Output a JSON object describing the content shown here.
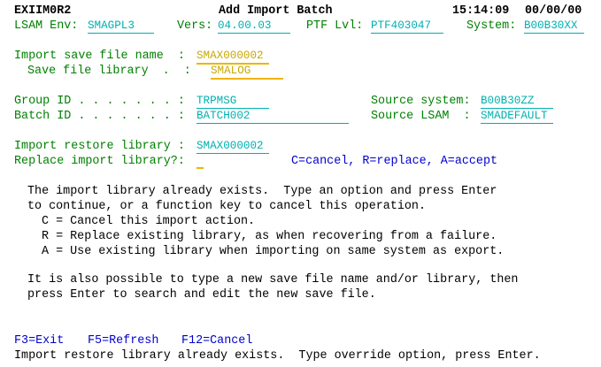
{
  "header": {
    "program_id": "EXIIM0R2",
    "title": "Add Import Batch",
    "time": "15:14:09",
    "date": "00/00/00",
    "lsam_env_label": "LSAM Env:",
    "lsam_env_value": "SMAGPL3",
    "vers_label": "Vers:",
    "vers_value": "04.00.03",
    "ptf_label": "PTF Lvl:",
    "ptf_value": "PTF403047",
    "system_label": "System:",
    "system_value": "B00B30XX"
  },
  "fields": {
    "save_file_name_label": "Import save file name  :",
    "save_file_name_value": "SMAX000002",
    "save_file_library_label": "Save file library  .  :",
    "save_file_library_value": "SMALOG",
    "group_id_label": "Group ID . . . . . . . :",
    "group_id_value": "TRPMSG",
    "source_system_label": "Source system:",
    "source_system_value": "B00B30ZZ",
    "batch_id_label": "Batch ID . . . . . . . :",
    "batch_id_value": "BATCH002",
    "source_lsam_label": "Source LSAM  :",
    "source_lsam_value": "SMADEFAULT",
    "restore_library_label": "Import restore library :",
    "restore_library_value": "SMAX000002",
    "replace_label": "Replace import library?:",
    "replace_value": "",
    "replace_options": "C=cancel, R=replace, A=accept"
  },
  "message": {
    "line1": "The import library already exists.  Type an option and press Enter",
    "line2": "to continue, or a function key to cancel this operation.",
    "line3": "C = Cancel this import action.",
    "line4": "R = Replace existing library, as when recovering from a failure.",
    "line5": "A = Use existing library when importing on same system as export.",
    "line6": "It is also possible to type a new save file name and/or library, then",
    "line7": "press Enter to search and edit the new save file."
  },
  "function_keys": {
    "f3": "F3=Exit",
    "f5": "F5=Refresh",
    "f12": "F12=Cancel"
  },
  "status_message": "Import restore library already exists.  Type override option, press Enter."
}
